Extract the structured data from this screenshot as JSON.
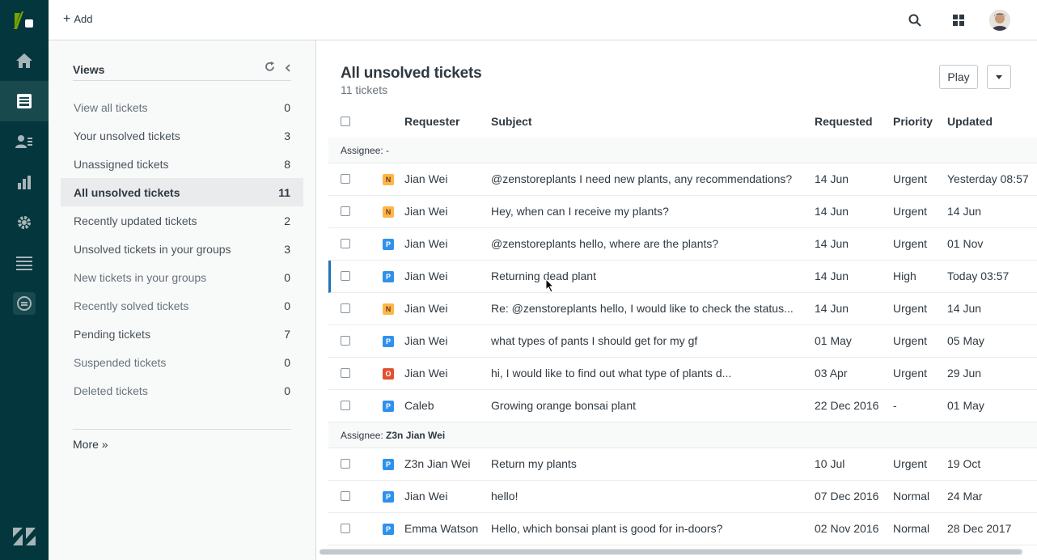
{
  "app": {
    "nav_items": [
      "home-icon",
      "tickets-icon",
      "users-icon",
      "reports-icon",
      "settings-icon",
      "views-list-icon",
      "chat-icon"
    ],
    "active_nav": "tickets-icon",
    "accent": "#03363d"
  },
  "topbar": {
    "add_label": "Add",
    "icons": [
      "search-icon",
      "apps-grid-icon",
      "avatar"
    ]
  },
  "views": {
    "title": "Views",
    "items": [
      {
        "label": "View all tickets",
        "count": "0",
        "dim": true
      },
      {
        "label": "Your unsolved tickets",
        "count": "3",
        "dim": false
      },
      {
        "label": "Unassigned tickets",
        "count": "8",
        "dim": false
      },
      {
        "label": "All unsolved tickets",
        "count": "11",
        "dim": false,
        "active": true
      },
      {
        "label": "Recently updated tickets",
        "count": "2",
        "dim": false
      },
      {
        "label": "Unsolved tickets in your groups",
        "count": "3",
        "dim": false
      },
      {
        "label": "New tickets in your groups",
        "count": "0",
        "dim": true
      },
      {
        "label": "Recently solved tickets",
        "count": "0",
        "dim": true
      },
      {
        "label": "Pending tickets",
        "count": "7",
        "dim": false
      },
      {
        "label": "Suspended tickets",
        "count": "0",
        "dim": true
      },
      {
        "label": "Deleted tickets",
        "count": "0",
        "dim": true
      }
    ],
    "more_label": "More »"
  },
  "main": {
    "title": "All unsolved tickets",
    "subtitle": "11 tickets",
    "play_label": "Play",
    "columns": [
      "Requester",
      "Subject",
      "Requested",
      "Priority",
      "Updated"
    ],
    "groups": [
      {
        "label": "Assignee: ",
        "name": "-",
        "rows": [
          {
            "status": "N",
            "requester": "Jian Wei",
            "subject": "@zenstoreplants I need new plants, any recommendations?",
            "requested": "14 Jun",
            "priority": "Urgent",
            "updated": "Yesterday 08:57"
          },
          {
            "status": "N",
            "requester": "Jian Wei",
            "subject": "Hey, when can I receive my plants?",
            "requested": "14 Jun",
            "priority": "Urgent",
            "updated": "14 Jun"
          },
          {
            "status": "P",
            "requester": "Jian Wei",
            "subject": "@zenstoreplants hello, where are the plants?",
            "requested": "14 Jun",
            "priority": "Urgent",
            "updated": "01 Nov"
          },
          {
            "status": "P",
            "requester": "Jian Wei",
            "subject": "Returning dead plant",
            "requested": "14 Jun",
            "priority": "High",
            "updated": "Today 03:57",
            "hover": true
          },
          {
            "status": "N",
            "requester": "Jian Wei",
            "subject": "Re: @zenstoreplants hello, I would like to check the status...",
            "requested": "14 Jun",
            "priority": "Urgent",
            "updated": "14 Jun"
          },
          {
            "status": "P",
            "requester": "Jian Wei",
            "subject": "what types of pants I should get for my gf",
            "requested": "01 May",
            "priority": "Urgent",
            "updated": "05 May"
          },
          {
            "status": "O",
            "requester": "Jian Wei",
            "subject": "hi, I would like to find out what type of plants d...",
            "requested": "03 Apr",
            "priority": "Urgent",
            "updated": "29 Jun"
          },
          {
            "status": "P",
            "requester": "Caleb",
            "subject": "Growing orange bonsai plant",
            "requested": "22 Dec 2016",
            "priority": "-",
            "updated": "01 May"
          }
        ]
      },
      {
        "label": "Assignee: ",
        "name": "Z3n Jian Wei",
        "rows": [
          {
            "status": "P",
            "requester": "Z3n Jian Wei",
            "subject": "Return my plants",
            "requested": "10 Jul",
            "priority": "Urgent",
            "updated": "19 Oct"
          },
          {
            "status": "P",
            "requester": "Jian Wei",
            "subject": "hello!",
            "requested": "07 Dec 2016",
            "priority": "Normal",
            "updated": "24 Mar"
          },
          {
            "status": "P",
            "requester": "Emma Watson",
            "subject": "Hello, which bonsai plant is good for in-doors?",
            "requested": "02 Nov 2016",
            "priority": "Normal",
            "updated": "28 Dec 2017"
          }
        ]
      }
    ]
  }
}
